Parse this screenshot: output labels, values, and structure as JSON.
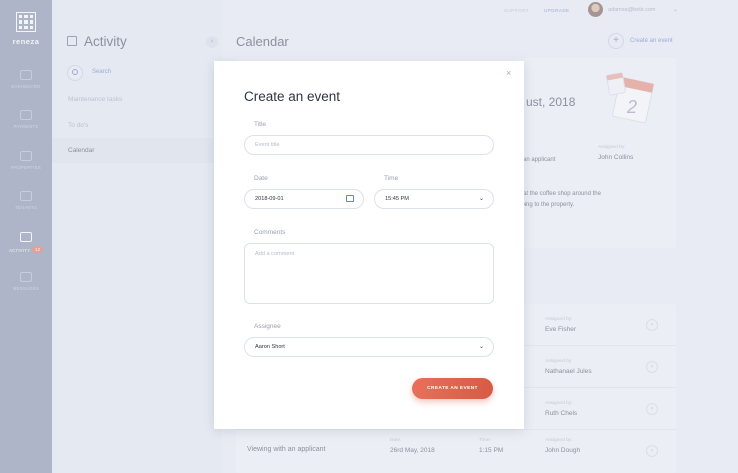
{
  "brand": {
    "name": "reneza"
  },
  "rail": [
    {
      "label": "DASHBOARD",
      "icon": "dashboard-icon"
    },
    {
      "label": "PAYMENTS",
      "icon": "payments-icon"
    },
    {
      "label": "PROPERTIES",
      "icon": "home-icon"
    },
    {
      "label": "TENANTS",
      "icon": "users-icon"
    },
    {
      "label": "ACTIVITY",
      "icon": "activity-icon",
      "badge": "12",
      "active": true
    },
    {
      "label": "MESSAGES",
      "icon": "mail-icon"
    }
  ],
  "subbar": {
    "title": "Activity",
    "search_label": "Search",
    "items": [
      {
        "label": "Maintenance tasks"
      },
      {
        "label": "To do's"
      },
      {
        "label": "Calendar",
        "active": true
      }
    ]
  },
  "topbar": {
    "support": "SUPPORT",
    "upgrade": "UPGRADE",
    "email": "adamsa@betir.com"
  },
  "main": {
    "title": "Calendar",
    "add_event": "Create an event",
    "card": {
      "date_partial": "ust, 2018",
      "calendar_day": "2",
      "title_partial": "n an applicant",
      "assigned_label": "Assigned by:",
      "assigned_value": "John Collins",
      "desc_line1": "e at the coffee shop around the",
      "desc_line2": "going to the property."
    },
    "rows": [
      {
        "assigned_label": "Assigned by:",
        "assigned_value": "Eve Fisher"
      },
      {
        "assigned_label": "Assigned by:",
        "assigned_value": "Nathanael Jules"
      },
      {
        "assigned_label": "Assigned by:",
        "assigned_value": "Ruth Chels"
      },
      {
        "title": "Viewing with an applicant",
        "date_label": "Date:",
        "date_value": "26rd May, 2018",
        "time_label": "Time:",
        "time_value": "1:15 PM",
        "assigned_label": "Assigned by:",
        "assigned_value": "John Dough"
      }
    ]
  },
  "modal": {
    "title": "Create an event",
    "close": "×",
    "title_label": "Title",
    "title_placeholder": "Event title",
    "date_label": "Date",
    "date_value": "2018-09-01",
    "time_label": "Time",
    "time_value": "15:45 PM",
    "comments_label": "Comments",
    "comments_placeholder": "Add a comment",
    "assignee_label": "Assignee",
    "assignee_value": "Aaron Short",
    "submit": "CREATE AN EVENT"
  },
  "colors": {
    "rail": "#8a93ac",
    "accent": "#6f7fd0",
    "cta": "#e26f5d",
    "badge": "#e26f5d"
  }
}
